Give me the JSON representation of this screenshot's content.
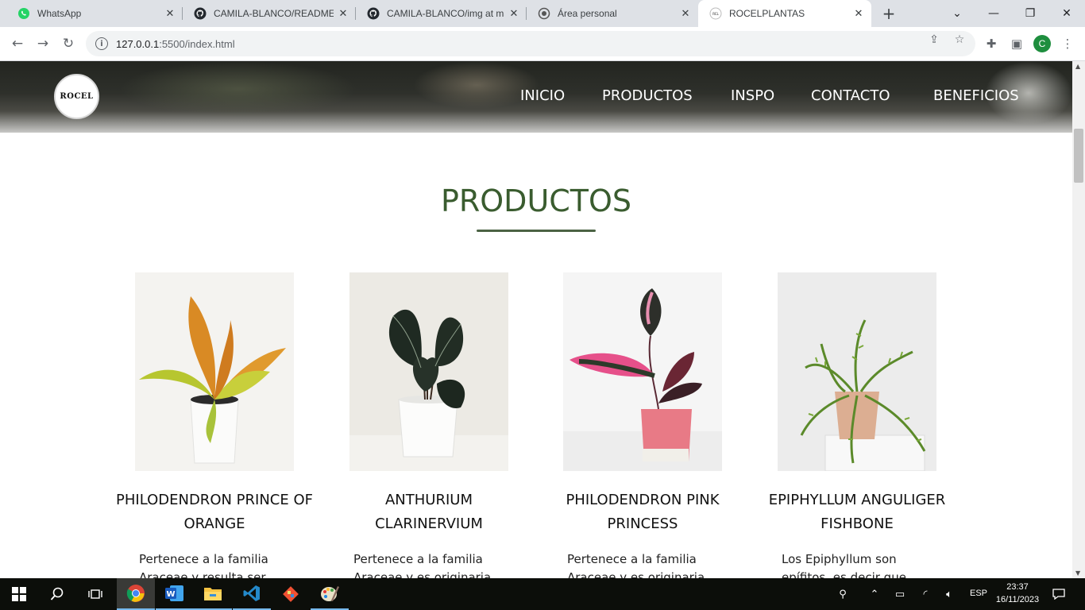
{
  "browser": {
    "tabs": [
      {
        "title": "WhatsApp",
        "icon": "whatsapp-icon"
      },
      {
        "title": "CAMILA-BLANCO/README.md",
        "icon": "github-icon"
      },
      {
        "title": "CAMILA-BLANCO/img at main",
        "icon": "github-icon"
      },
      {
        "title": "Área personal",
        "icon": "moodle-icon"
      },
      {
        "title": "ROCELPLANTAS",
        "icon": "rocel-icon",
        "active": true
      }
    ],
    "new_tab_label": "+",
    "url_host": "127.0.0.1",
    "url_rest": ":5500/index.html",
    "profile_initial": "C"
  },
  "site": {
    "logo_text": "ROCEL",
    "nav": [
      "INICIO",
      "PRODUCTOS",
      "INSPO",
      "CONTACTO",
      "BENEFICIOS"
    ],
    "section_title": "PRODUCTOS",
    "products": [
      {
        "name": "PHILODENDRON PRINCE OF ORANGE",
        "name_line1": "PHILODENDRON PRINCE OF",
        "name_line2": "ORANGE",
        "desc_line1": "Pertenece a la familia",
        "desc_line2": "Araceae y resulta ser"
      },
      {
        "name": "ANTHURIUM CLARINERVIUM",
        "name_line1": "ANTHURIUM",
        "name_line2": "CLARINERVIUM",
        "desc_line1": "Pertenece a la familia",
        "desc_line2": "Araceae y es originaria"
      },
      {
        "name": "PHILODENDRON PINK PRINCESS",
        "name_line1": "PHILODENDRON PINK",
        "name_line2": "PRINCESS",
        "desc_line1": "Pertenece a la familia",
        "desc_line2": "Araceae y es originaria"
      },
      {
        "name": "EPIPHYLLUM ANGULIGER FISHBONE",
        "name_line1": "EPIPHYLLUM ANGULIGER",
        "name_line2": "FISHBONE",
        "desc_line1": "Los Epiphyllum son",
        "desc_line2": "epífitos, es decir que"
      }
    ],
    "colors": {
      "title": "#3a5c2f",
      "underline": "#4b6344"
    }
  },
  "taskbar": {
    "apps": [
      "start-icon",
      "search-icon",
      "task-view-icon",
      "chrome-icon",
      "word-icon",
      "file-explorer-icon",
      "vscode-icon",
      "git-icon",
      "paint-icon"
    ],
    "language": "ESP",
    "time": "23:37",
    "date": "16/11/2023"
  }
}
